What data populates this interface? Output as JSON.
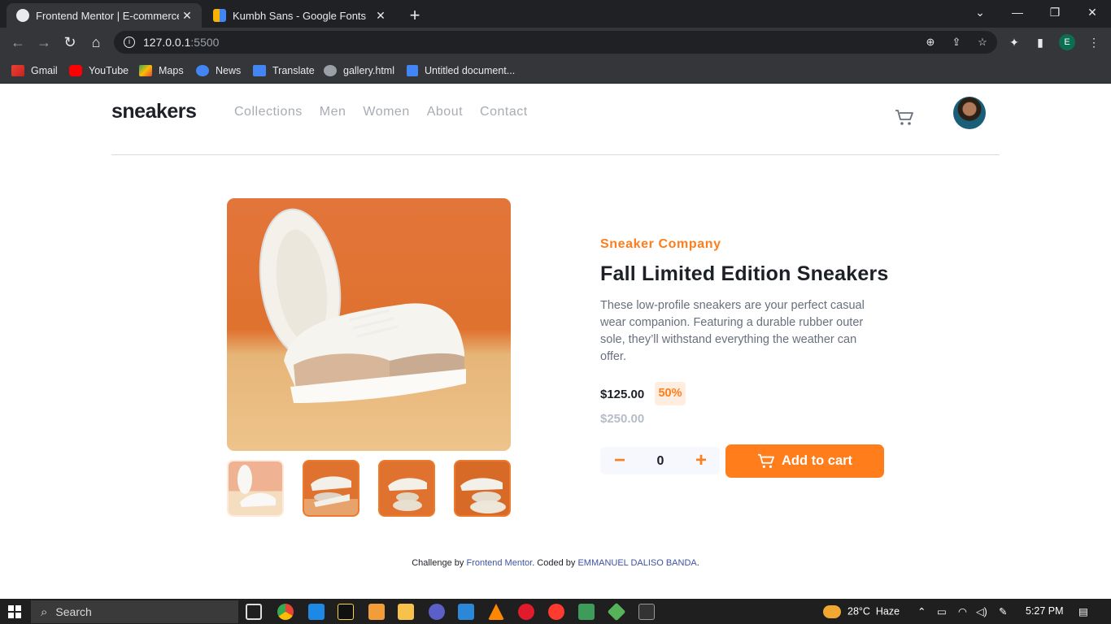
{
  "browser": {
    "tabs": [
      {
        "title": "Frontend Mentor | E-commerce p",
        "active": true
      },
      {
        "title": "Kumbh Sans - Google Fonts",
        "active": false
      }
    ],
    "url_host": "127.0.0.1",
    "url_port": ":5500",
    "profile_initial": "E",
    "bookmarks": [
      "Gmail",
      "YouTube",
      "Maps",
      "News",
      "Translate",
      "gallery.html",
      "Untitled document..."
    ]
  },
  "site": {
    "logo": "sneakers",
    "nav": [
      "Collections",
      "Men",
      "Women",
      "About",
      "Contact"
    ]
  },
  "product": {
    "company": "Sneaker Company",
    "title": "Fall Limited Edition Sneakers",
    "description": "These low-profile sneakers are your perfect casual wear companion. Featuring a durable rubber outer sole, they’ll withstand everything the weather can offer.",
    "price": "$125.00",
    "discount": "50%",
    "old_price": "$250.00",
    "quantity": "0",
    "minus": "−",
    "plus": "+",
    "add_to_cart": "Add to cart"
  },
  "footer": {
    "prefix": "Challenge by ",
    "fm": "Frontend Mentor",
    "mid": ". Coded by ",
    "author": "EMMANUEL DALISO BANDA",
    "suffix": "."
  },
  "taskbar": {
    "search_label": "Search",
    "temperature": "28°C",
    "weather": "Haze",
    "time": "5:27 PM"
  },
  "colors": {
    "accent": "#ff7d1a",
    "dark": "#1d2026",
    "grey": "#68707d"
  }
}
